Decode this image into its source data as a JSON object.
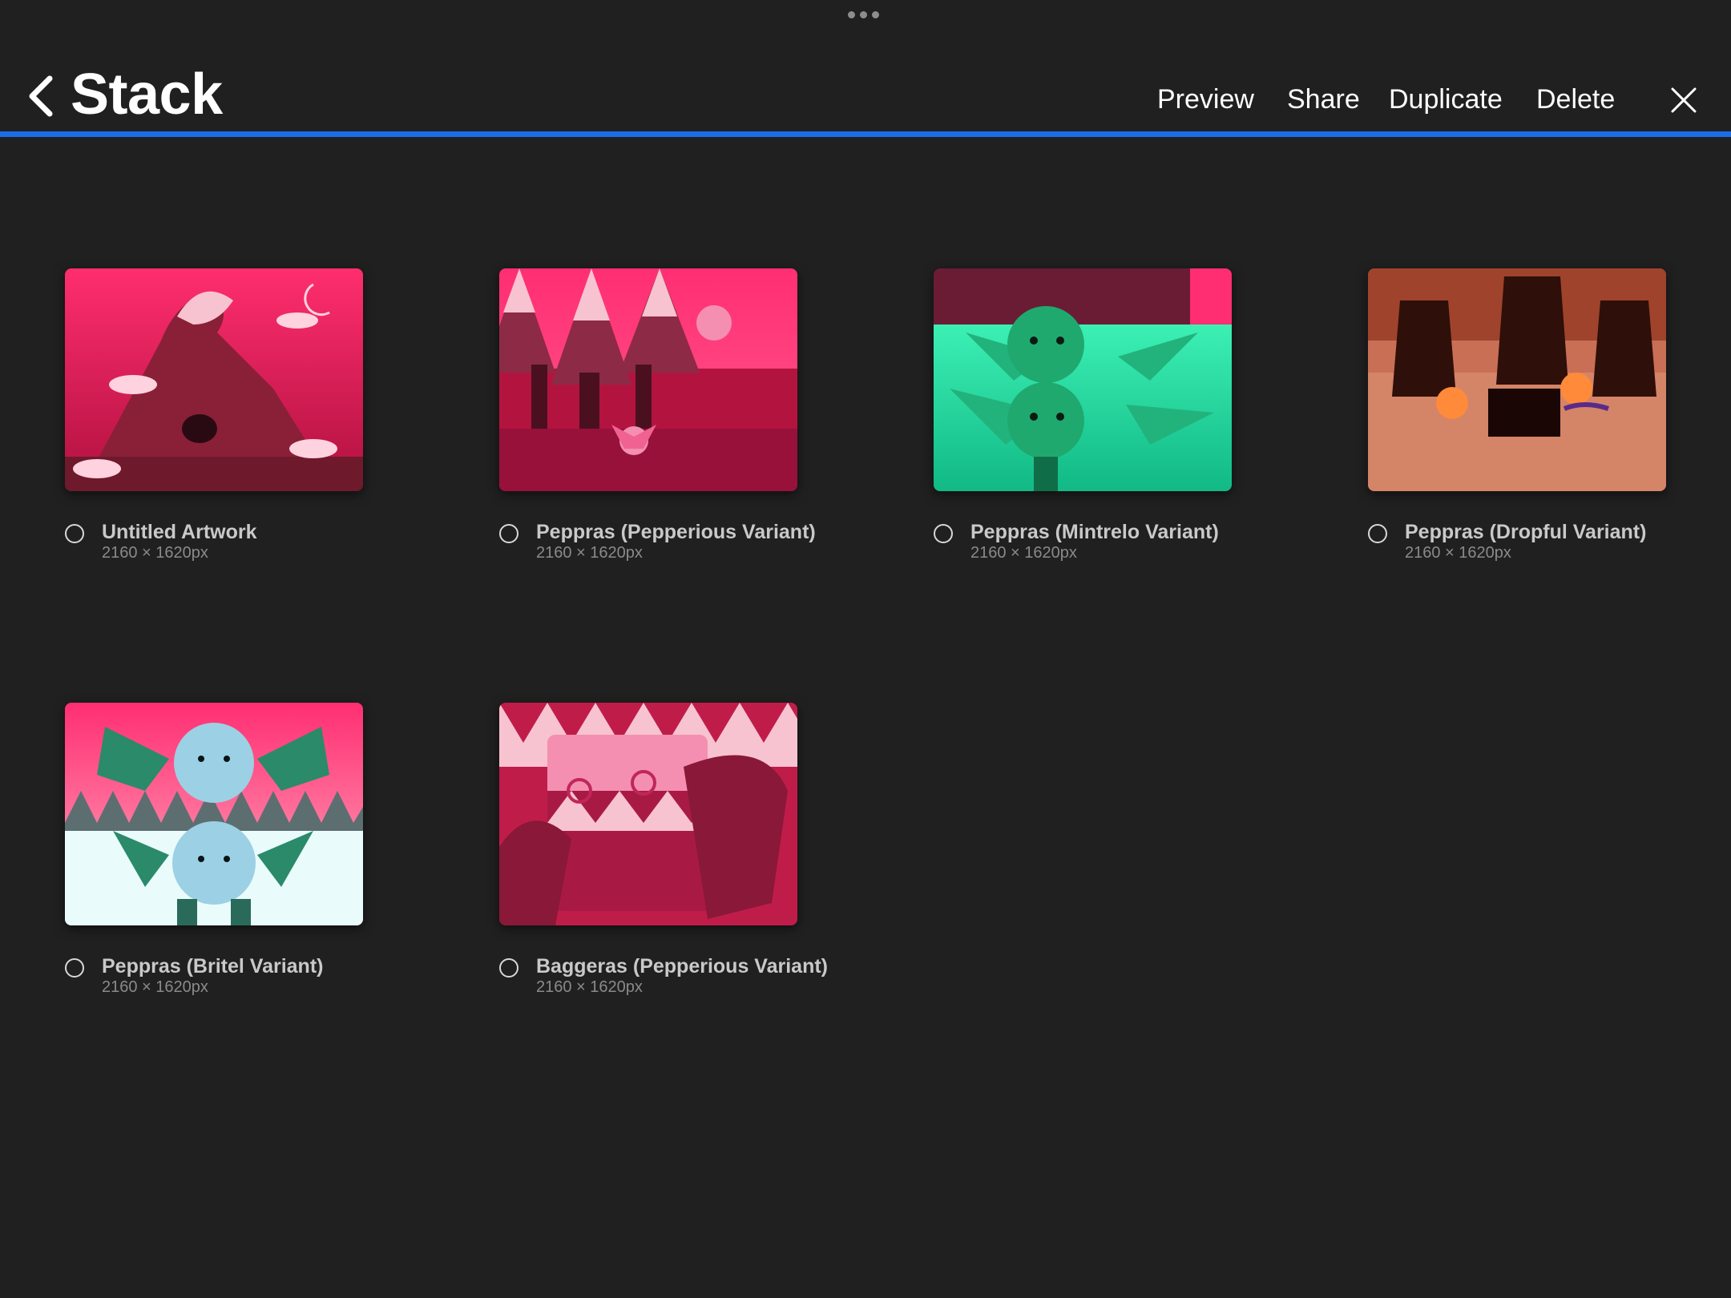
{
  "header": {
    "title": "Stack",
    "actions": {
      "preview": "Preview",
      "share": "Share",
      "duplicate": "Duplicate",
      "delete": "Delete"
    },
    "back_icon": "chevron-left-icon",
    "close_icon": "close-icon",
    "accent_color": "#1a6fe6"
  },
  "artworks": [
    {
      "title": "Untitled Artwork",
      "dims": "2160 × 1620px",
      "palette": "pink"
    },
    {
      "title": "Peppras (Pepperious Variant)",
      "dims": "2160 × 1620px",
      "palette": "pink"
    },
    {
      "title": "Peppras (Mintrelo Variant)",
      "dims": "2160 × 1620px",
      "palette": "mint"
    },
    {
      "title": "Peppras (Dropful Variant)",
      "dims": "2160 × 1620px",
      "palette": "orange"
    },
    {
      "title": "Peppras (Britel Variant)",
      "dims": "2160 × 1620px",
      "palette": "snow"
    },
    {
      "title": "Baggeras (Pepperious Variant)",
      "dims": "2160 × 1620px",
      "palette": "crimson"
    }
  ],
  "colors": {
    "background": "#202020",
    "text_primary": "#ffffff",
    "text_card_title": "#c9c9c9",
    "text_card_dims": "#8a8a8a"
  }
}
